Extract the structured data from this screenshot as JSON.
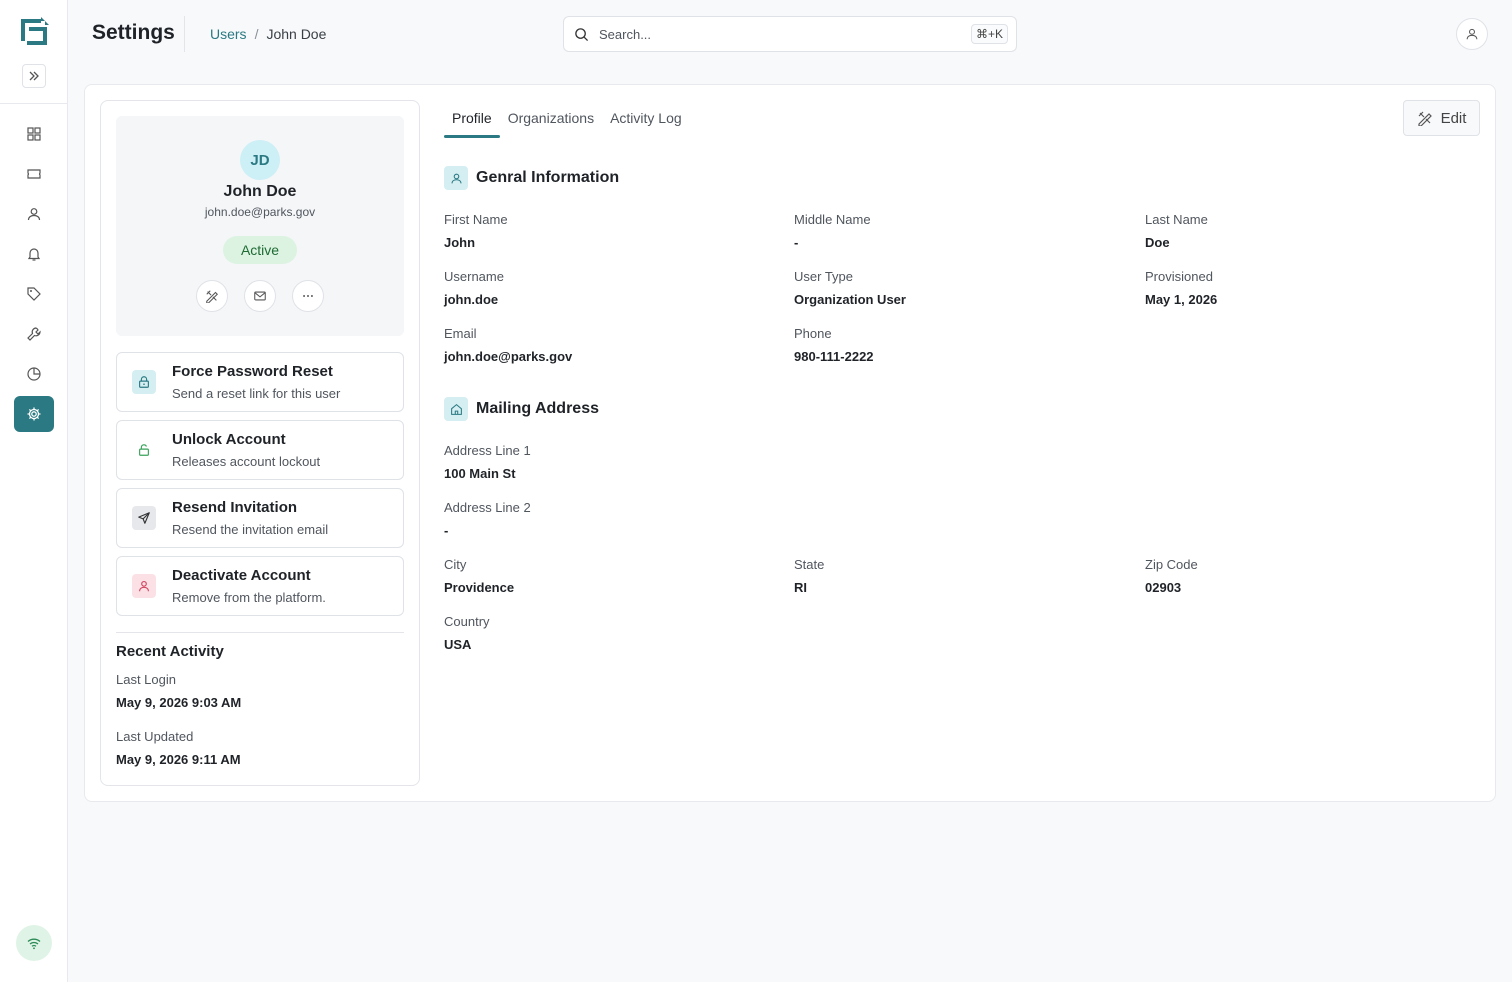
{
  "header": {
    "title": "Settings",
    "breadcrumb": {
      "parent": "Users",
      "separator": "/",
      "current": "John Doe"
    },
    "search": {
      "placeholder": "Search...",
      "shortcut": "⌘+K"
    }
  },
  "sidebar": {
    "items": [
      {
        "icon": "grid-icon"
      },
      {
        "icon": "ticket-icon"
      },
      {
        "icon": "user-icon"
      },
      {
        "icon": "bell-icon"
      },
      {
        "icon": "tag-icon"
      },
      {
        "icon": "wrench-icon"
      },
      {
        "icon": "pie-chart-icon"
      },
      {
        "icon": "gear-icon",
        "active": true
      }
    ]
  },
  "profile": {
    "initials": "JD",
    "name": "John Doe",
    "email": "john.doe@parks.gov",
    "status": "Active"
  },
  "actions": [
    {
      "title": "Force Password Reset",
      "subtitle": "Send a reset link for this user",
      "icon": "lock-icon"
    },
    {
      "title": "Unlock Account",
      "subtitle": "Releases account lockout",
      "icon": "unlock-icon"
    },
    {
      "title": "Resend Invitation",
      "subtitle": "Resend the invitation email",
      "icon": "send-icon"
    },
    {
      "title": "Deactivate Account",
      "subtitle": "Remove from the platform.",
      "icon": "user-x-icon"
    }
  ],
  "recent": {
    "title": "Recent Activity",
    "last_login_label": "Last Login",
    "last_login": "May 9, 2026 9:03 AM",
    "last_updated_label": "Last Updated",
    "last_updated": "May 9, 2026 9:11 AM"
  },
  "tabs": [
    "Profile",
    "Organizations",
    "Activity Log"
  ],
  "edit_label": "Edit",
  "general": {
    "title": "Genral Information",
    "fields": {
      "first_name": {
        "label": "First Name",
        "value": "John"
      },
      "middle_name": {
        "label": "Middle Name",
        "value": "-"
      },
      "last_name": {
        "label": "Last Name",
        "value": "Doe"
      },
      "username": {
        "label": "Username",
        "value": "john.doe"
      },
      "user_type": {
        "label": "User Type",
        "value": "Organization User"
      },
      "provisioned": {
        "label": "Provisioned",
        "value": "May 1, 2026"
      },
      "email": {
        "label": "Email",
        "value": "john.doe@parks.gov"
      },
      "phone": {
        "label": "Phone",
        "value": "980-111-2222"
      }
    }
  },
  "mailing": {
    "title": "Mailing Address",
    "fields": {
      "address1": {
        "label": "Address Line 1",
        "value": "100 Main St"
      },
      "address2": {
        "label": "Address Line 2",
        "value": "-"
      },
      "city": {
        "label": "City",
        "value": "Providence"
      },
      "state": {
        "label": "State",
        "value": "RI"
      },
      "zip": {
        "label": "Zip Code",
        "value": "02903"
      },
      "country": {
        "label": "Country",
        "value": "USA"
      }
    }
  },
  "colors": {
    "accent": "#2b7a83",
    "active_badge": "#dcf3e2"
  }
}
